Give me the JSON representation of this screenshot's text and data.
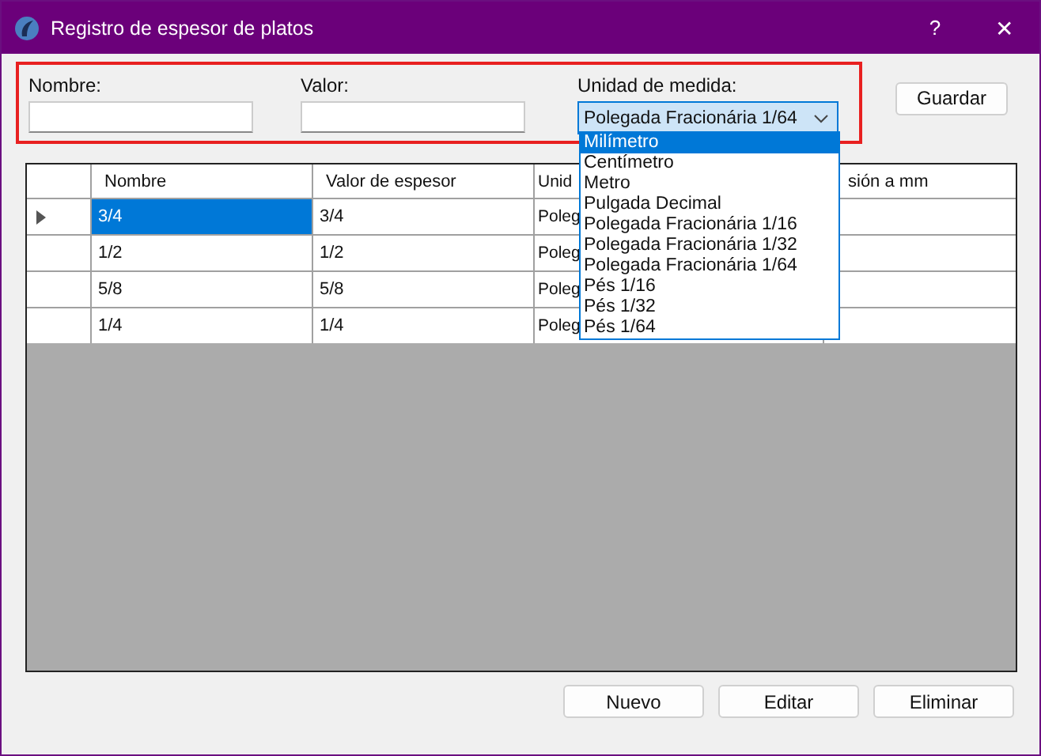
{
  "window": {
    "title": "Registro de espesor de platos",
    "help": "?",
    "close": "✕"
  },
  "form": {
    "fields": [
      {
        "label": "Nombre:"
      },
      {
        "label": "Valor:"
      }
    ],
    "unit": {
      "label": "Unidad de medida:",
      "value": "Polegada Fracionária 1/64",
      "expanded": true,
      "options": [
        {
          "label": "Milímetro",
          "highlighted": true
        },
        {
          "label": "Centímetro",
          "highlighted": false
        },
        {
          "label": "Metro",
          "highlighted": false
        },
        {
          "label": "Pulgada Decimal",
          "highlighted": false
        },
        {
          "label": "Polegada Fracionária 1/16",
          "highlighted": false
        },
        {
          "label": "Polegada Fracionária 1/32",
          "highlighted": false
        },
        {
          "label": "Polegada Fracionária 1/64",
          "highlighted": false
        },
        {
          "label": "Pés 1/16",
          "highlighted": false
        },
        {
          "label": "Pés 1/32",
          "highlighted": false
        },
        {
          "label": "Pés 1/64",
          "highlighted": false
        }
      ]
    },
    "save": "Guardar"
  },
  "table": {
    "columns": [
      "Nombre",
      "Valor de espesor",
      "Unid",
      "sión a mm"
    ],
    "rows": [
      {
        "cells": [
          "3/4",
          "3/4",
          "Poleg",
          ""
        ],
        "selected": true
      },
      {
        "cells": [
          "1/2",
          "1/2",
          "Poleg",
          ""
        ],
        "selected": false
      },
      {
        "cells": [
          "5/8",
          "5/8",
          "Poleg",
          ""
        ],
        "selected": false
      },
      {
        "cells": [
          "1/4",
          "1/4",
          "Poleg",
          ""
        ],
        "selected": false
      }
    ]
  },
  "buttons": [
    "Nuevo",
    "Editar",
    "Eliminar"
  ]
}
